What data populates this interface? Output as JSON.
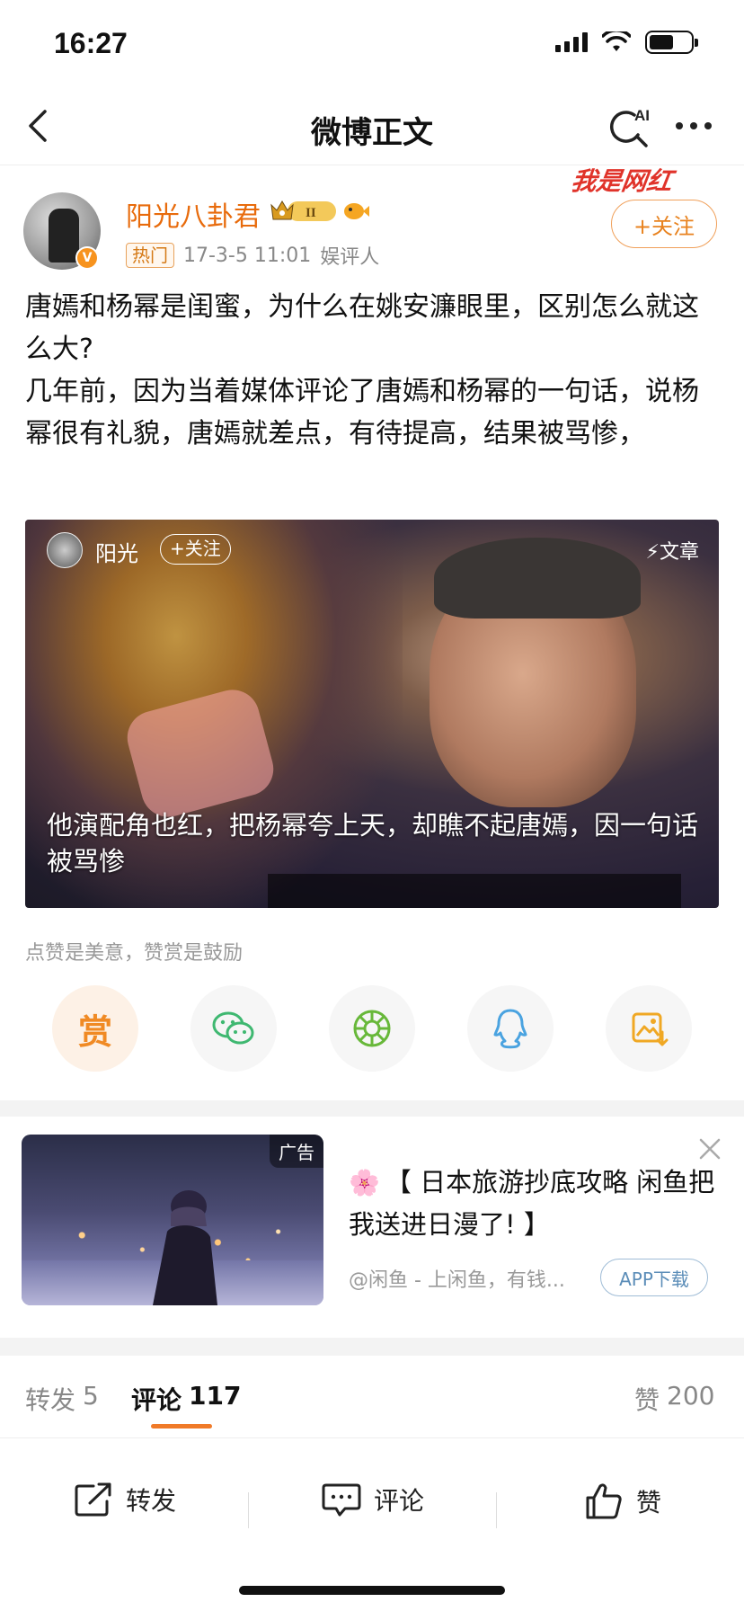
{
  "status_bar": {
    "time": "16:27"
  },
  "nav": {
    "title": "微博正文",
    "ai_label": "AI"
  },
  "post": {
    "author": "阳光八卦君",
    "vip_level": "II",
    "hot_tag": "热门",
    "timestamp": "17-3-5 11:01",
    "author_role": "娱评人",
    "follow_label": "+关注",
    "watermark": "我是网红",
    "body_lines": [
      "唐嫣和杨幂是闺蜜，为什么在姚安濂眼里，区别怎么就这么大?",
      "几年前，因为当着媒体评论了唐嫣和杨幂的一句话，说杨幂很有礼貌，唐嫣就差点，有待提高，结果被骂惨，"
    ]
  },
  "video_card": {
    "author": "阳光",
    "follow_label": "+关注",
    "tag": "⚡文章",
    "caption": "他演配角也红，把杨幂夸上天，却瞧不起唐嫣，因一句话被骂惨"
  },
  "reward_hint": "点赞是美意，赞赏是鼓励",
  "share": {
    "reward_label": "赏",
    "items": [
      "reward",
      "wechat",
      "moments",
      "qq",
      "save-image"
    ]
  },
  "ad": {
    "badge": "广告",
    "title": "【 日本旅游抄底攻略 闲鱼把我送进日漫了! 】",
    "source": "@闲鱼 - 上闲鱼，有钱...",
    "download_label": "APP下载"
  },
  "tabs": {
    "repost_label": "转发",
    "repost_count": "5",
    "comment_label": "评论",
    "comment_count": "117",
    "like_label": "赞",
    "like_count": "200"
  },
  "bottom_bar": {
    "repost": "转发",
    "comment": "评论",
    "like": "赞"
  },
  "colors": {
    "accent_orange": "#f07a28",
    "username": "#e86b0c",
    "follow_border": "#f0a05a"
  }
}
